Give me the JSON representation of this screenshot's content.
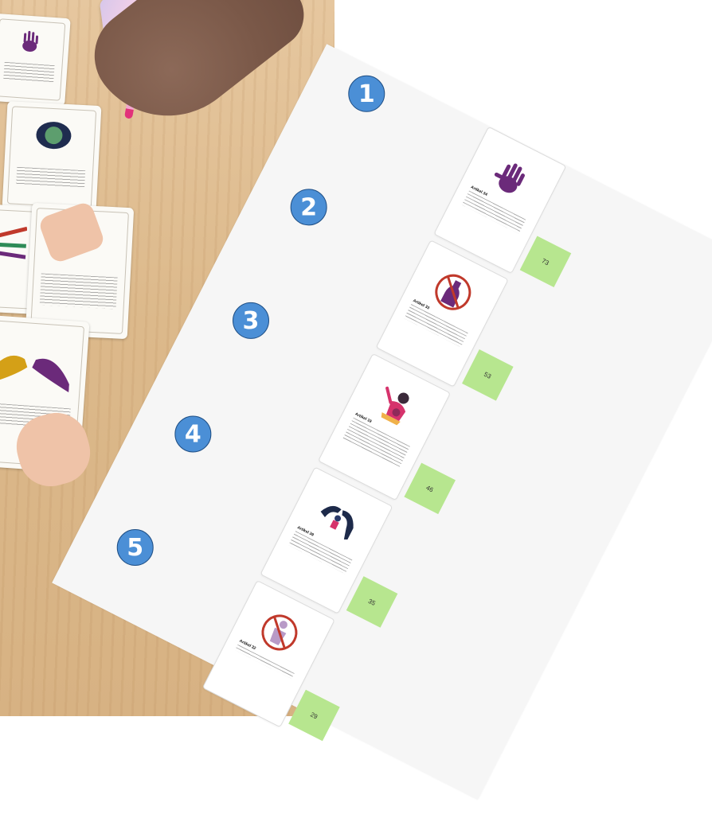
{
  "steps": [
    {
      "number": "1",
      "card_title": "Artikel 34",
      "score": "73",
      "icon": "handprint-icon",
      "accent": "#6b2a7a"
    },
    {
      "number": "2",
      "card_title": "Artikel 33",
      "score": "53",
      "icon": "no-alcohol-icon",
      "accent": "#c0392b"
    },
    {
      "number": "3",
      "card_title": "Artikel 19",
      "score": "46",
      "icon": "distress-figure-icon",
      "accent": "#d6336c"
    },
    {
      "number": "4",
      "card_title": "Artikel 39",
      "score": "35",
      "icon": "protecting-hands-icon",
      "accent": "#1d2a4a"
    },
    {
      "number": "5",
      "card_title": "Artikel 32",
      "score": "29",
      "icon": "no-child-labor-icon",
      "accent": "#c0392b"
    }
  ],
  "colors": {
    "number_circle": "#4b8fd6",
    "score_box": "#b7e68f",
    "sheet": "#f6f6f6"
  }
}
